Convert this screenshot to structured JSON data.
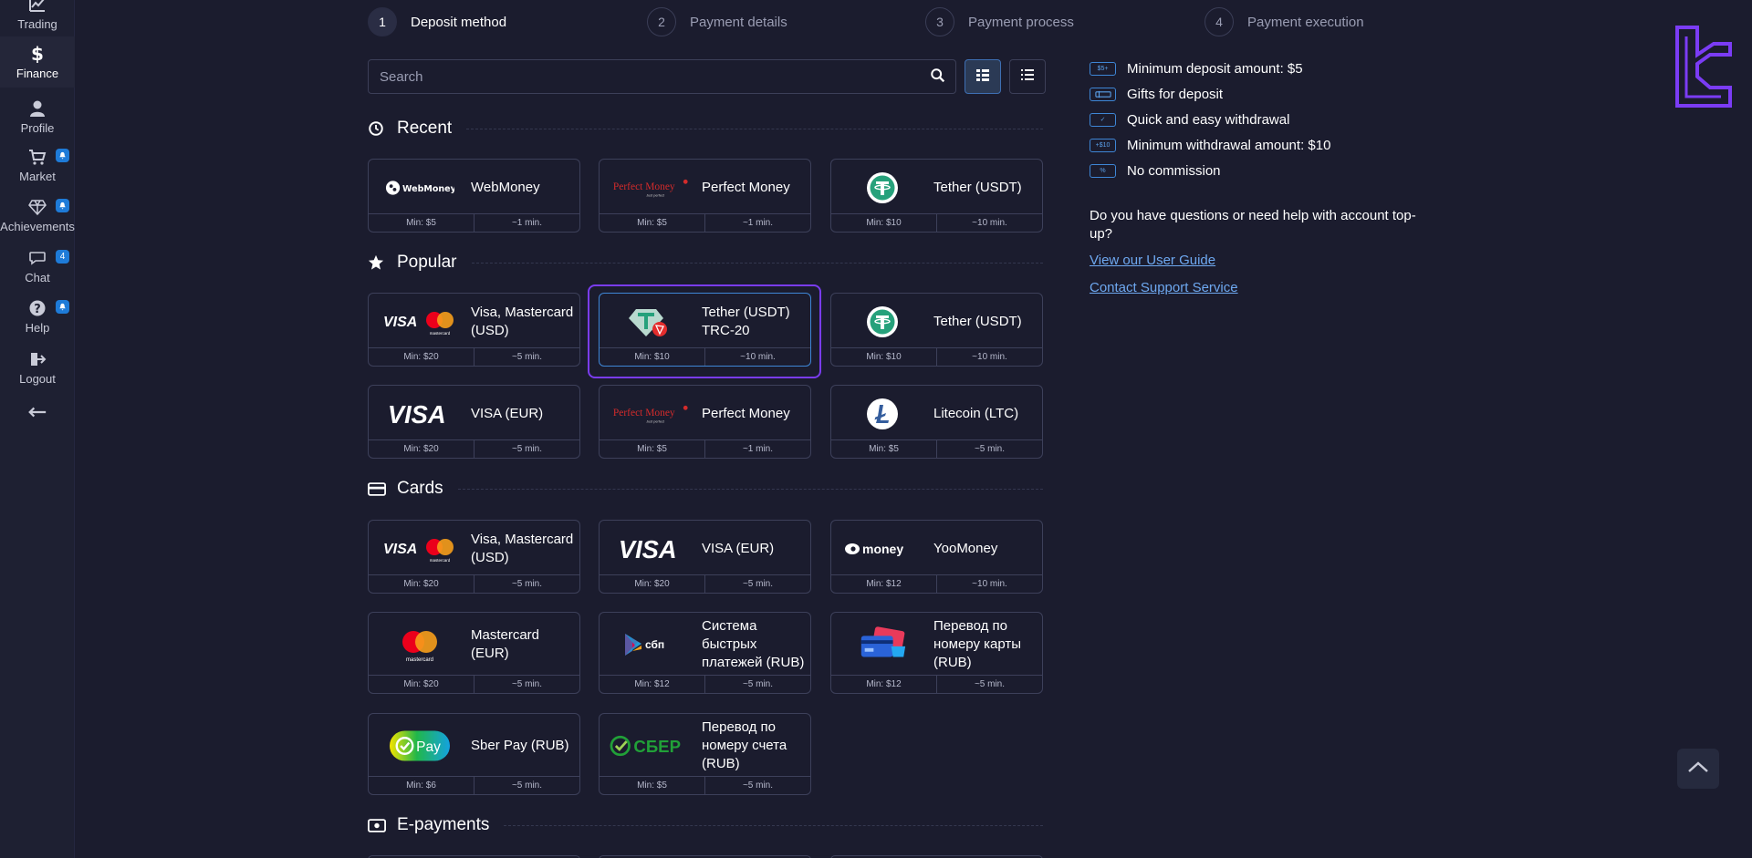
{
  "sidebar": {
    "items": [
      {
        "label": "Trading",
        "icon": "chart-line-icon"
      },
      {
        "label": "Finance",
        "icon": "dollar-icon"
      },
      {
        "label": "Profile",
        "icon": "user-icon"
      },
      {
        "label": "Market",
        "icon": "cart-icon",
        "badge": ""
      },
      {
        "label": "Achievements",
        "icon": "diamond-icon",
        "badge": ""
      },
      {
        "label": "Chat",
        "icon": "chat-icon",
        "badge": "4"
      },
      {
        "label": "Help",
        "icon": "help-icon",
        "badge": ""
      },
      {
        "label": "Logout",
        "icon": "logout-icon"
      }
    ],
    "collapse_icon": "arrow-left-icon"
  },
  "steps": [
    {
      "num": "1",
      "label": "Deposit method"
    },
    {
      "num": "2",
      "label": "Payment details"
    },
    {
      "num": "3",
      "label": "Payment process"
    },
    {
      "num": "4",
      "label": "Payment execution"
    }
  ],
  "search": {
    "placeholder": "Search"
  },
  "sections": {
    "recent": "Recent",
    "popular": "Popular",
    "cards": "Cards",
    "epayments": "E-payments"
  },
  "recent": [
    {
      "name": "WebMoney",
      "min": "Min: $5",
      "time": "~1 min."
    },
    {
      "name": "Perfect Money",
      "min": "Min: $5",
      "time": "~1 min."
    },
    {
      "name": "Tether (USDT)",
      "min": "Min: $10",
      "time": "~10 min."
    }
  ],
  "popular": [
    {
      "name": "Visa, Mastercard (USD)",
      "min": "Min: $20",
      "time": "~5 min."
    },
    {
      "name": "Tether (USDT) TRC-20",
      "min": "Min: $10",
      "time": "~10 min."
    },
    {
      "name": "Tether (USDT)",
      "min": "Min: $10",
      "time": "~10 min."
    },
    {
      "name": "VISA (EUR)",
      "min": "Min: $20",
      "time": "~5 min."
    },
    {
      "name": "Perfect Money",
      "min": "Min: $5",
      "time": "~1 min."
    },
    {
      "name": "Litecoin (LTC)",
      "min": "Min: $5",
      "time": "~5 min."
    }
  ],
  "cards": [
    {
      "name": "Visa, Mastercard (USD)",
      "min": "Min: $20",
      "time": "~5 min."
    },
    {
      "name": "VISA (EUR)",
      "min": "Min: $20",
      "time": "~5 min."
    },
    {
      "name": "YooMoney",
      "min": "Min: $12",
      "time": "~10 min."
    },
    {
      "name": "Mastercard (EUR)",
      "min": "Min: $20",
      "time": "~5 min."
    },
    {
      "name": "Система быстрых платежей (RUB)",
      "min": "Min: $12",
      "time": "~5 min."
    },
    {
      "name": "Перевод по номеру карты (RUB)",
      "min": "Min: $12",
      "time": "~5 min."
    },
    {
      "name": "Sber Pay (RUB)",
      "min": "Min: $6",
      "time": "~5 min."
    },
    {
      "name": "Перевод по номеру счета (RUB)",
      "min": "Min: $5",
      "time": "~5 min."
    }
  ],
  "logos": {
    "webmoney": "WebMoney",
    "perfect_money": "Perfect Money",
    "perfect_money_tag": "Just perfect",
    "visa": "VISA",
    "mastercard": "mastercard",
    "yoomoney": "money",
    "sbp": "сбп",
    "sber": "СБЕР",
    "sberpay": "Pay"
  },
  "features": [
    {
      "icon": "$5+",
      "text": "Minimum deposit amount: $5"
    },
    {
      "icon": "",
      "text": "Gifts for deposit"
    },
    {
      "icon": "✓",
      "text": "Quick and easy withdrawal"
    },
    {
      "icon": "+$10",
      "text": "Minimum withdrawal amount: $10"
    },
    {
      "icon": "%",
      "text": "No commission"
    }
  ],
  "help": {
    "question": "Do you have questions or need help with account top-up?",
    "guide_link": "View our User Guide",
    "support_link": "Contact Support Service"
  },
  "colors": {
    "background": "#1b1c2e",
    "accent_blue": "#3e86d6",
    "selection_purple": "#7a3cf0",
    "link": "#6ea8f0",
    "tether_green": "#26a17b"
  }
}
